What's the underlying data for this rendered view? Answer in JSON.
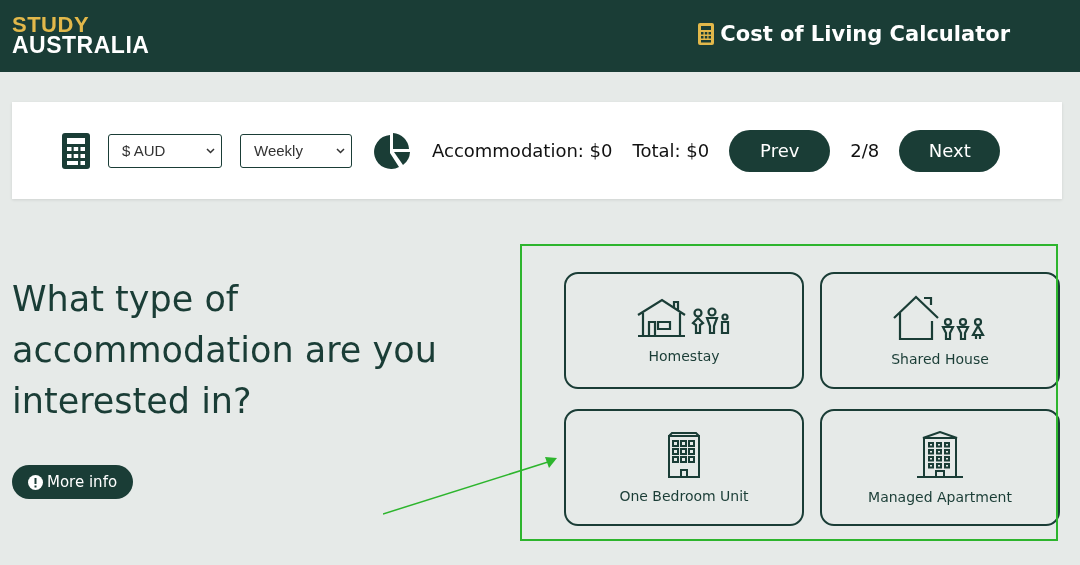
{
  "header": {
    "logo_top": "STUDY",
    "logo_bottom": "AUSTRALIA",
    "title": "Cost of Living Calculator"
  },
  "toolbar": {
    "currency": "$ AUD",
    "period": "Weekly",
    "accommodation": "Accommodation: $0",
    "total": "Total: $0",
    "prev": "Prev",
    "step": "2/8",
    "next": "Next"
  },
  "question": {
    "heading": "What type of accommodation are you interested in?",
    "more_info": "More info"
  },
  "options": [
    {
      "kind": "homestay",
      "label": "Homestay"
    },
    {
      "kind": "shared",
      "label": "Shared House"
    },
    {
      "kind": "unit",
      "label": "One Bedroom Unit"
    },
    {
      "kind": "apartment",
      "label": "Managed Apartment"
    }
  ]
}
